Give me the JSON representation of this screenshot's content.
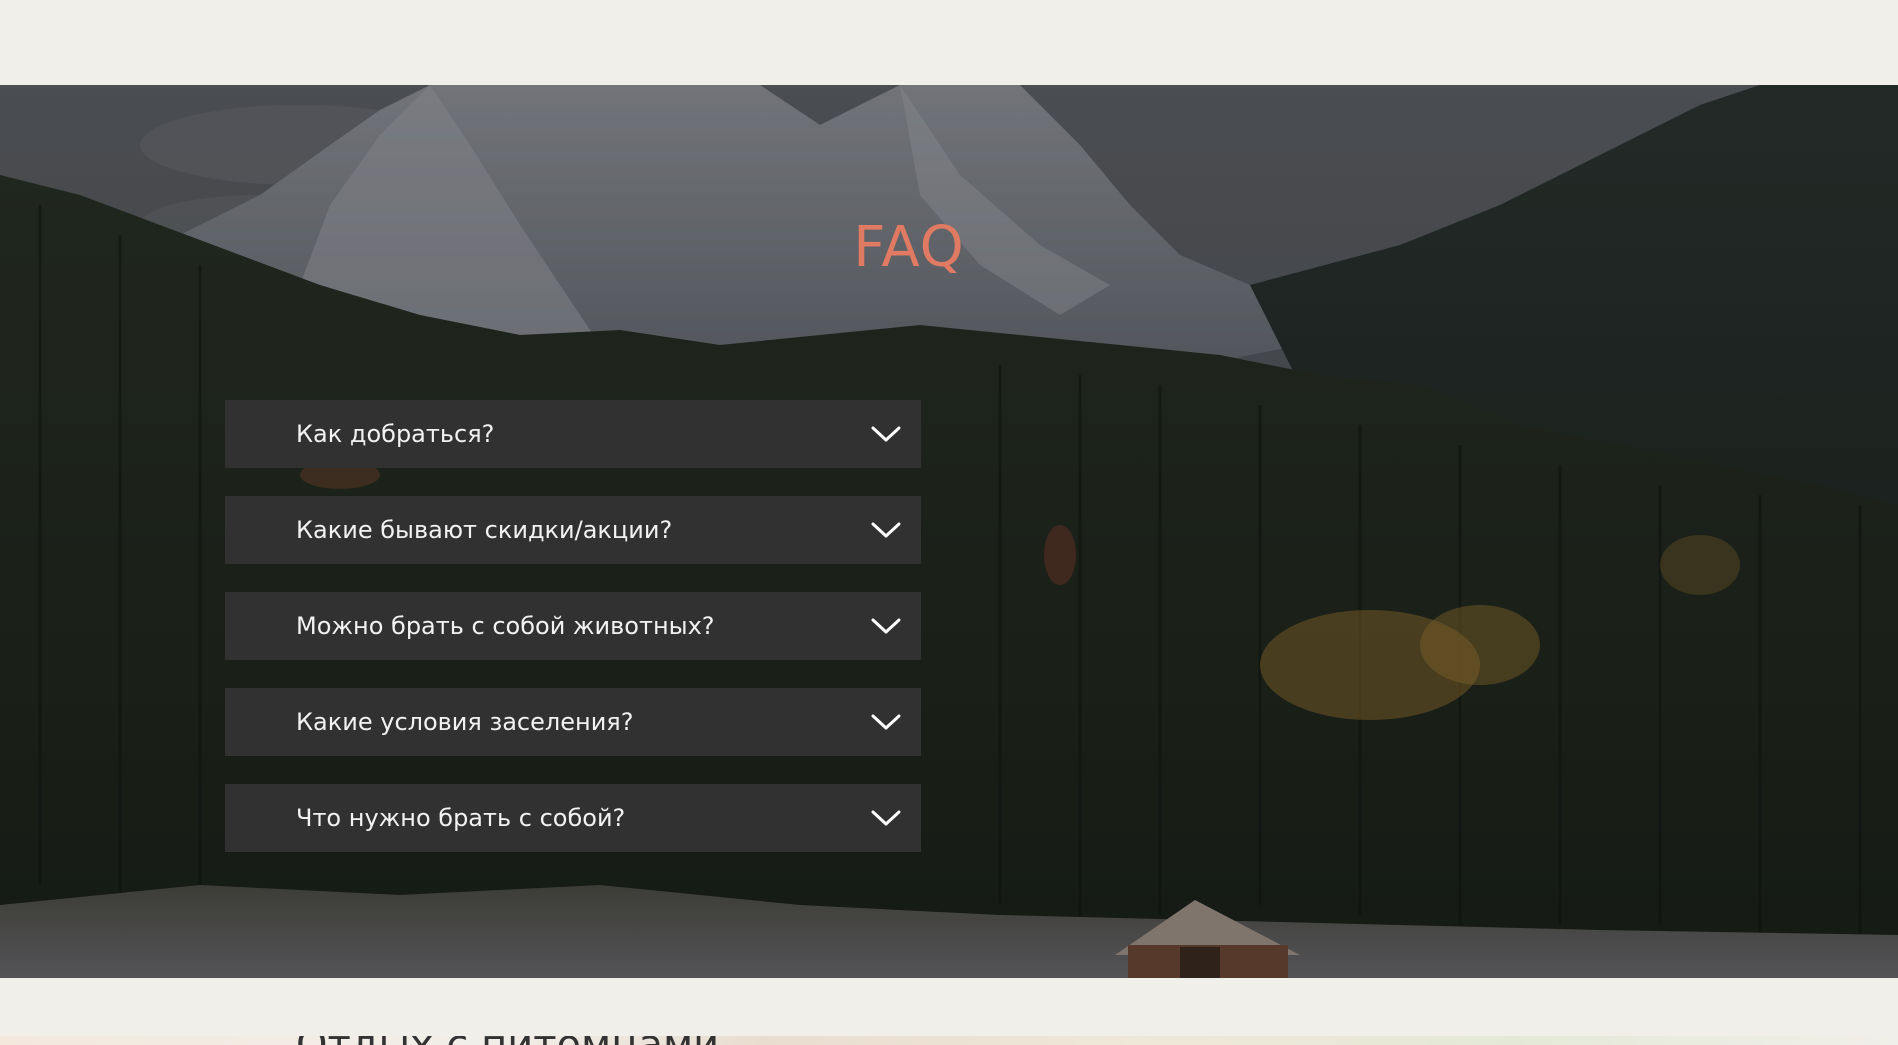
{
  "faq": {
    "title": "FAQ",
    "items": [
      {
        "question": "Как добраться?"
      },
      {
        "question": "Какие бывают скидки/акции?"
      },
      {
        "question": "Можно брать с собой животных?"
      },
      {
        "question": "Какие условия заселения?"
      },
      {
        "question": "Что нужно брать с собой?"
      }
    ]
  },
  "next_section": {
    "heading": "Отдых с питомцами"
  },
  "colors": {
    "page_background": "#f0efea",
    "title_accent": "#e07a63",
    "accordion_background": "#313131",
    "accordion_text": "#f2f2f2"
  },
  "icons": {
    "accordion_toggle": "chevron-down-icon"
  }
}
